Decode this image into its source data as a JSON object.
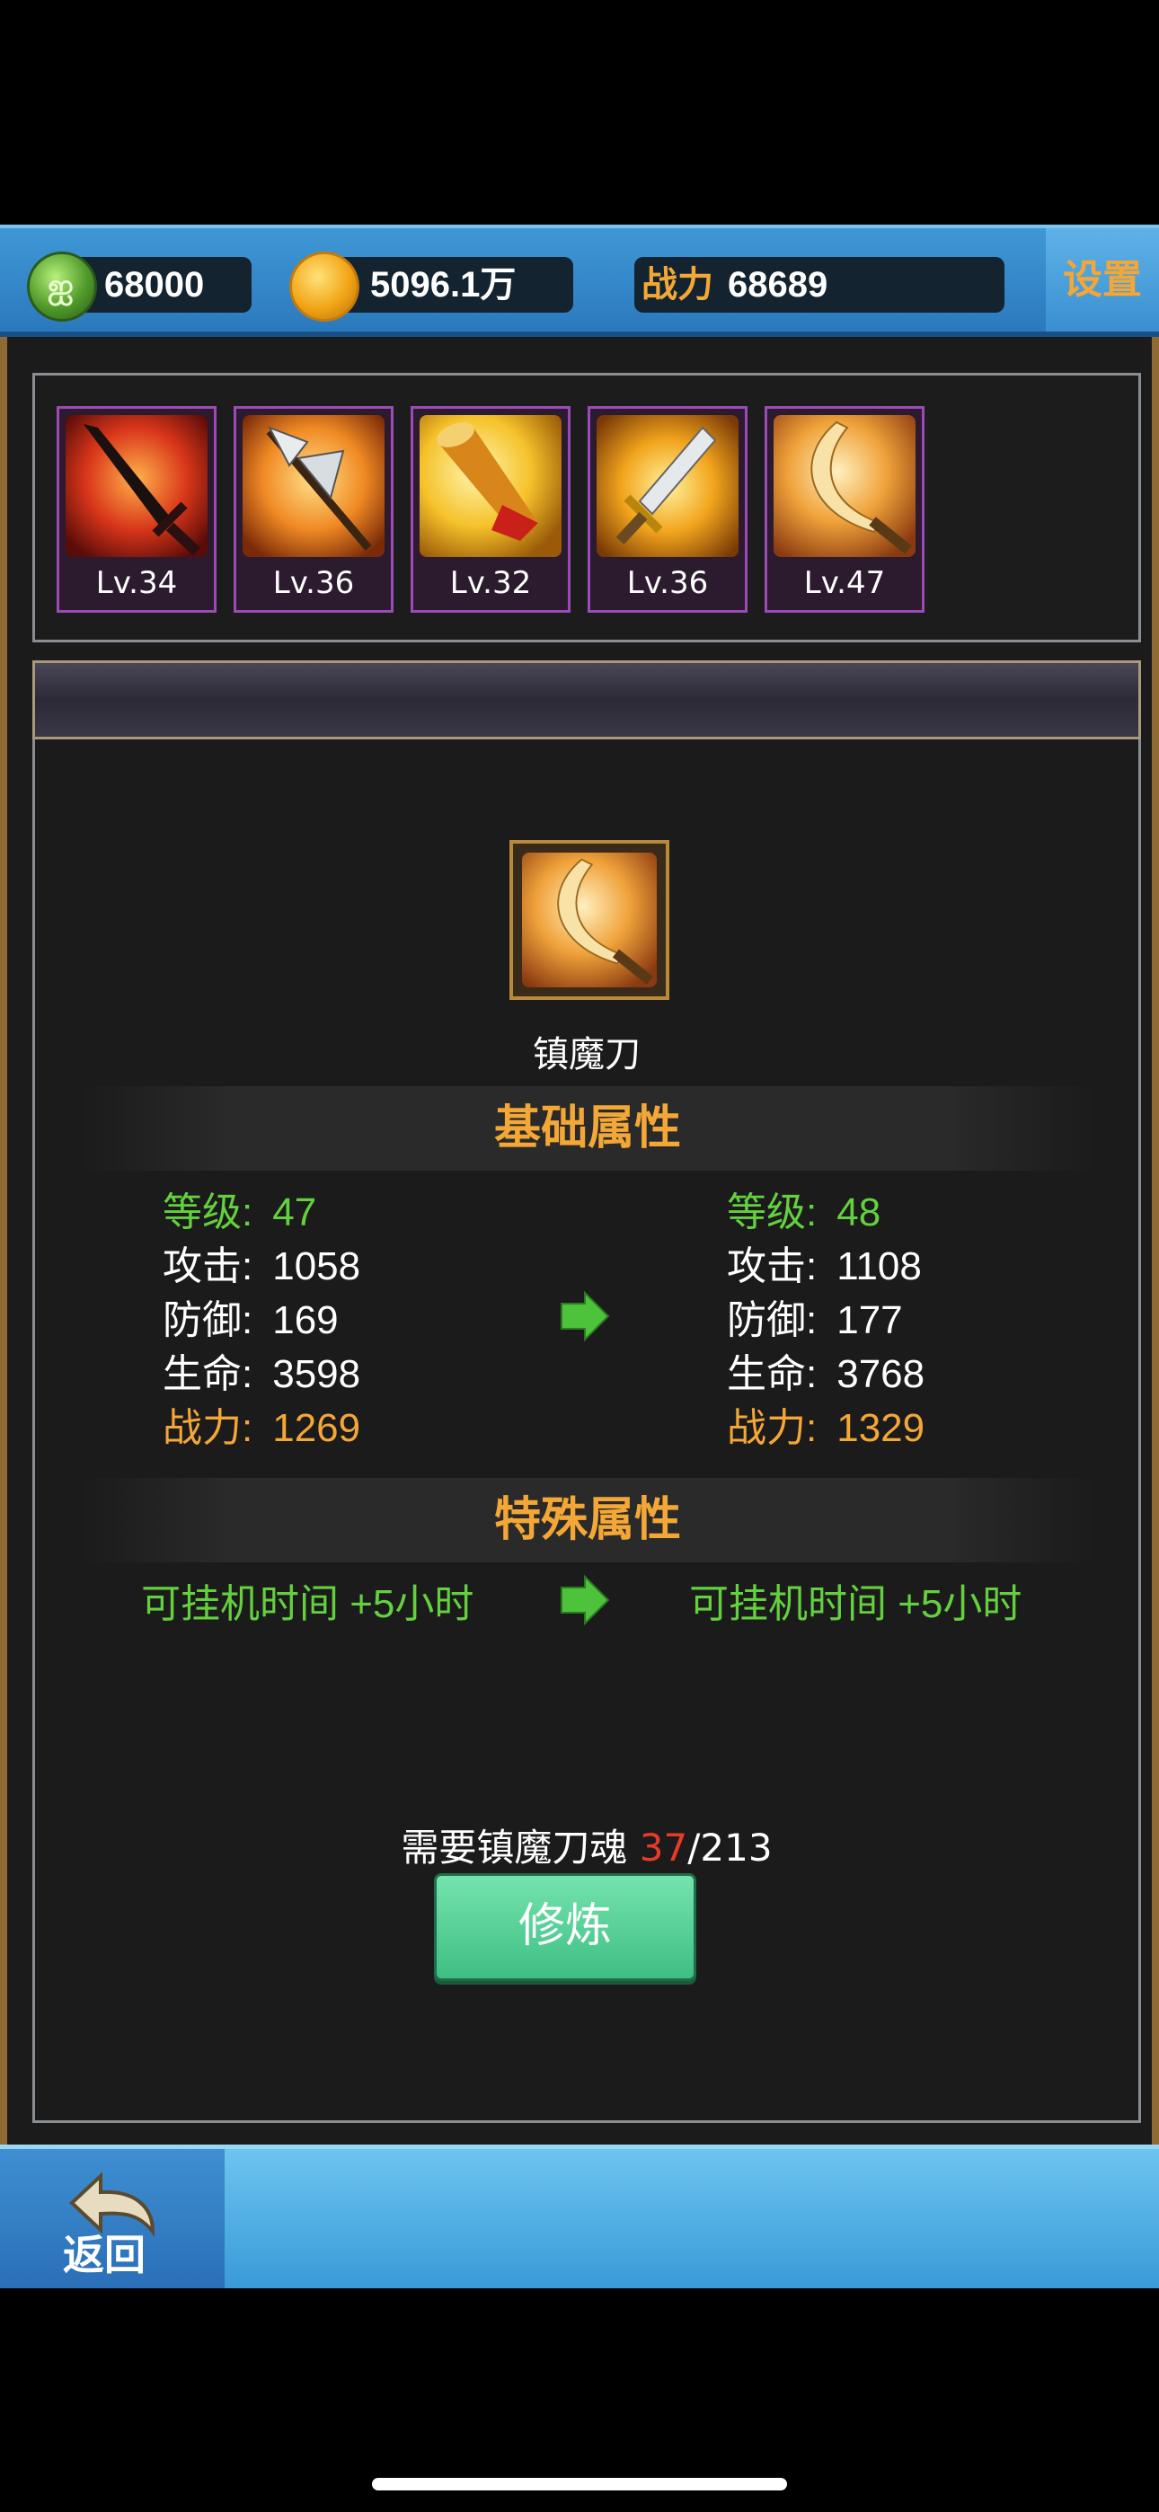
{
  "topbar": {
    "jade_amount": "68000",
    "gold_amount": "5096.1万",
    "power_label": "战力",
    "power_value": "68689",
    "settings_label": "设置"
  },
  "weapons": [
    {
      "level": "Lv.34",
      "icon": "black-sword-icon"
    },
    {
      "level": "Lv.36",
      "icon": "halberd-icon"
    },
    {
      "level": "Lv.32",
      "icon": "war-horn-icon"
    },
    {
      "level": "Lv.36",
      "icon": "golden-sword-icon"
    },
    {
      "level": "Lv.47",
      "icon": "curved-saber-icon"
    }
  ],
  "selected": {
    "name": "镇魔刀",
    "icon": "curved-saber-icon"
  },
  "basic": {
    "title": "基础属性",
    "current": [
      {
        "label": "等级:",
        "value": "47"
      },
      {
        "label": "攻击:",
        "value": "1058"
      },
      {
        "label": "防御:",
        "value": "169"
      },
      {
        "label": "生命:",
        "value": "3598"
      },
      {
        "label": "战力:",
        "value": "1269"
      }
    ],
    "next": [
      {
        "label": "等级:",
        "value": "48"
      },
      {
        "label": "攻击:",
        "value": "1108"
      },
      {
        "label": "防御:",
        "value": "177"
      },
      {
        "label": "生命:",
        "value": "3768"
      },
      {
        "label": "战力:",
        "value": "1329"
      }
    ]
  },
  "special": {
    "title": "特殊属性",
    "current": "可挂机时间 +5小时",
    "next": "可挂机时间 +5小时"
  },
  "requirement": {
    "prefix": "需要镇魔刀魂 ",
    "have": "37",
    "total": "/213"
  },
  "cultivate_label": "修炼",
  "back_label": "返回",
  "colors": {
    "accent_orange": "#f3a736",
    "stat_green": "#63d13e",
    "need_red": "#e83a2a",
    "button_green": "#4fcf92"
  }
}
